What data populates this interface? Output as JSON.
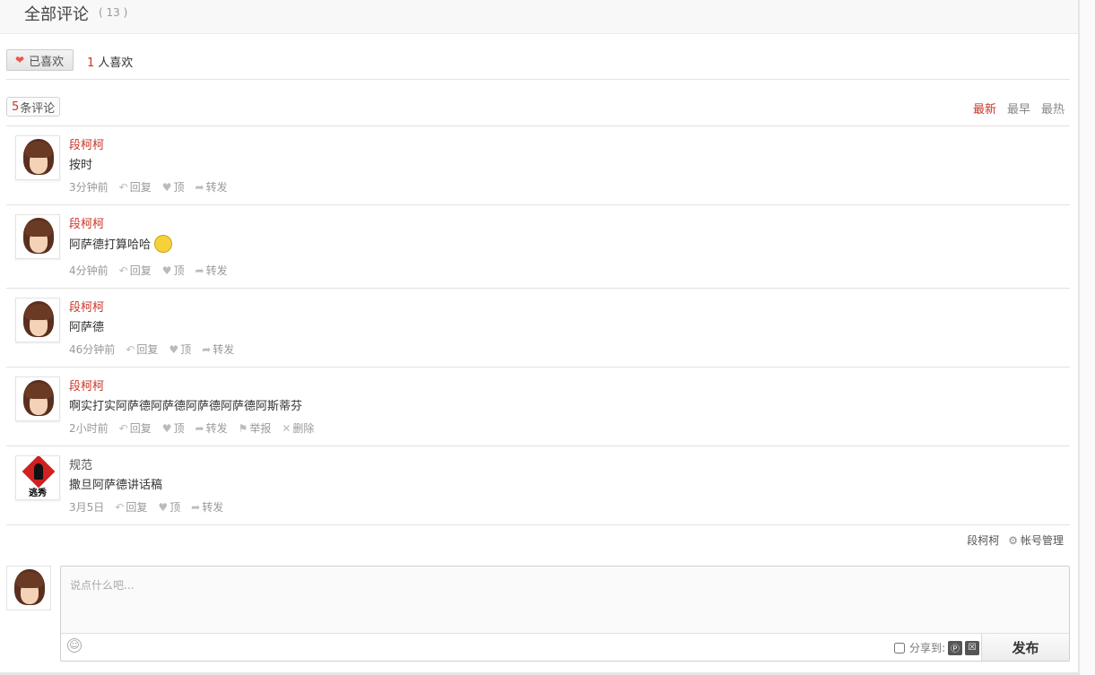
{
  "header": {
    "title": "全部评论",
    "count": "( 13 )"
  },
  "like": {
    "button_label": "已喜欢",
    "count": "1",
    "suffix": "人喜欢"
  },
  "comments_header": {
    "count": "5",
    "label": "条评论",
    "sort": [
      "最新",
      "最早",
      "最热"
    ]
  },
  "comments": [
    {
      "author": "段柯柯",
      "text": "按时",
      "time": "3分钟前",
      "actions": [
        "回复",
        "顶",
        "转发"
      ]
    },
    {
      "author": "段柯柯",
      "text": "阿萨德打算哈哈",
      "time": "4分钟前",
      "actions": [
        "回复",
        "顶",
        "转发"
      ]
    },
    {
      "author": "段柯柯",
      "text": "阿萨德",
      "time": "46分钟前",
      "actions": [
        "回复",
        "顶",
        "转发"
      ]
    },
    {
      "author": "段柯柯",
      "text": "啊实打实阿萨德阿萨德阿萨德阿萨德阿斯蒂芬",
      "time": "2小时前",
      "actions": [
        "回复",
        "顶",
        "转发",
        "举报",
        "删除"
      ]
    },
    {
      "author": "规范",
      "text": "撒旦阿萨德讲话稿",
      "time": "3月5日",
      "actions": [
        "回复",
        "顶",
        "转发"
      ]
    }
  ],
  "logo_text": "逃秀",
  "user": {
    "name": "段柯柯",
    "account_label": "帐号管理"
  },
  "composer": {
    "placeholder": "说点什么吧...",
    "share_label": "分享到:",
    "publish_label": "发布"
  }
}
